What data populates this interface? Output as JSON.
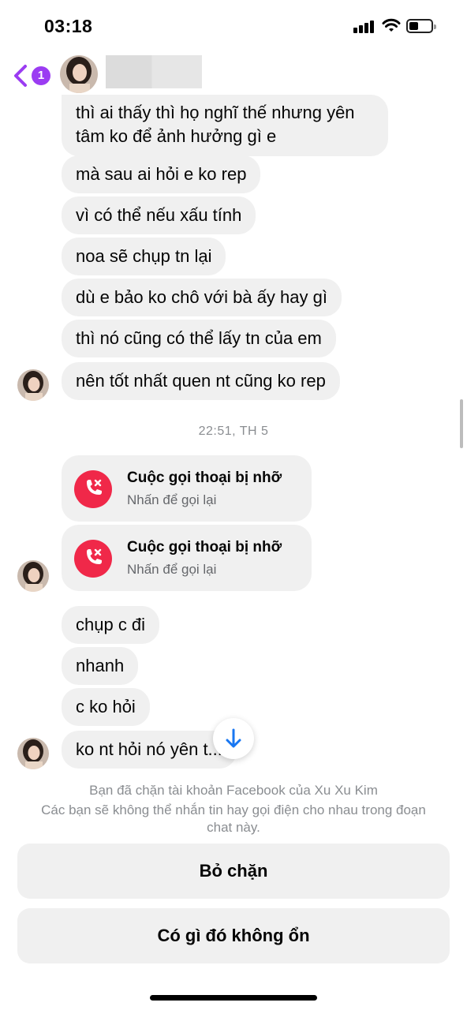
{
  "status_bar": {
    "time": "03:18"
  },
  "header": {
    "back_badge": "1"
  },
  "messages": [
    {
      "text": "thì ai thấy thì họ nghĩ thế nhưng yên tâm ko để ảnh hưởng gì e"
    },
    {
      "text": "mà sau ai hỏi e ko rep"
    },
    {
      "text": "vì có thể nếu xấu tính"
    },
    {
      "text": "noa sẽ chụp tn lại"
    },
    {
      "text": "dù e bảo ko chô với bà ấy hay gì"
    },
    {
      "text": "thì nó cũng có thể lấy tn của em"
    },
    {
      "text": "nên tốt nhất quen nt cũng ko rep"
    }
  ],
  "timestamp": "22:51, TH 5",
  "missed_calls": [
    {
      "title": "Cuộc gọi thoại bị nhỡ",
      "subtitle": "Nhấn để gọi lại"
    },
    {
      "title": "Cuộc gọi thoại bị nhỡ",
      "subtitle": "Nhấn để gọi lại"
    }
  ],
  "messages_after": [
    {
      "text": "chụp c đi"
    },
    {
      "text": "nhanh"
    },
    {
      "text": "c ko hỏi"
    },
    {
      "text": "ko nt hỏi nó yên t..."
    }
  ],
  "footer": {
    "blocked_title": "Bạn đã chặn tài khoản Facebook của Xu Xu Kim",
    "blocked_desc": "Các bạn sẽ không thể nhắn tin hay gọi điện cho nhau trong đoạn chat này.",
    "unblock_label": "Bỏ chặn",
    "report_label": "Có gì đó không ổn"
  },
  "colors": {
    "accent": "#9b3cf2",
    "bubble_bg": "#f0f0f0",
    "missed_call_red": "#f02849",
    "muted_text": "#8a8d91"
  }
}
